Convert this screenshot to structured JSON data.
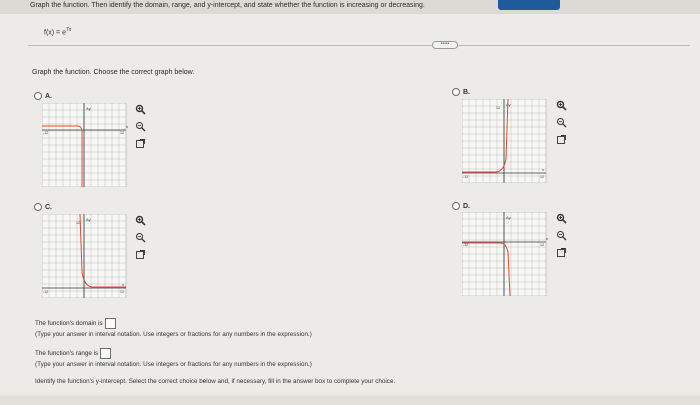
{
  "header": {
    "instruction": "Graph the function. Then identify the domain, range, and y-intercept, and state whether the function is increasing or decreasing."
  },
  "function": {
    "lhs": "f(x) = e",
    "exponent": "7x"
  },
  "divider_handle": "•••••",
  "question": {
    "text": "Graph the function. Choose the correct graph below."
  },
  "options": [
    {
      "letter": "A.",
      "selected": false
    },
    {
      "letter": "B.",
      "selected": false
    },
    {
      "letter": "C.",
      "selected": false
    },
    {
      "letter": "D.",
      "selected": false
    }
  ],
  "graph_labels": {
    "x_axis": "x",
    "y_axis": "Ay",
    "tick_neg": "-12",
    "tick_pos": "12",
    "tick_mid_neg": "-8",
    "tick_mid_pos": "8",
    "tick_top": "12"
  },
  "tool_icons": [
    "zoom-in-icon",
    "zoom-out-icon",
    "popout-icon"
  ],
  "answers": {
    "domain_prompt": "The function's domain is",
    "domain_hint": "(Type your answer in interval notation. Use integers or fractions for any numbers in the expression.)",
    "range_prompt": "The function's range is",
    "range_hint": "(Type your answer in interval notation. Use integers or fractions for any numbers in the expression.)",
    "yint_prompt": "Identify the function's y-intercept. Select the correct choice below and, if necessary, fill in the answer box to complete your choice."
  },
  "colors": {
    "curve": "#e8472f",
    "grid": "#9a9a9a",
    "accent": "#1f5b9a"
  }
}
